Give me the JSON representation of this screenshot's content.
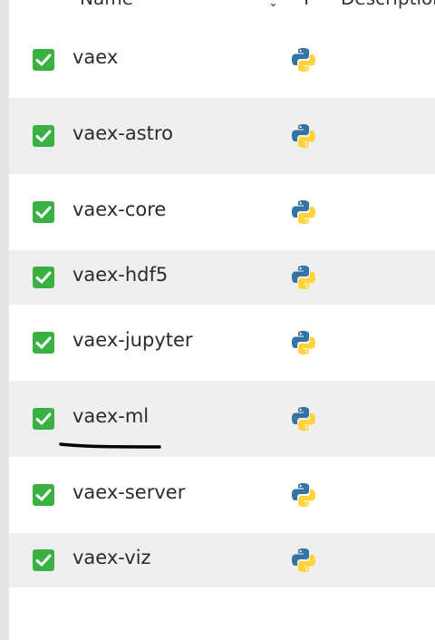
{
  "header": {
    "name_label": "Name",
    "sort_indicator": "⌄",
    "type_label": "T",
    "description_label": "Description"
  },
  "packages": [
    {
      "name": "vaex",
      "checked": true,
      "icon": "python-icon"
    },
    {
      "name": "vaex-astro",
      "checked": true,
      "icon": "python-icon"
    },
    {
      "name": "vaex-core",
      "checked": true,
      "icon": "python-icon"
    },
    {
      "name": "vaex-hdf5",
      "checked": true,
      "icon": "python-icon"
    },
    {
      "name": "vaex-jupyter",
      "checked": true,
      "icon": "python-icon"
    },
    {
      "name": "vaex-ml",
      "checked": true,
      "icon": "python-icon"
    },
    {
      "name": "vaex-server",
      "checked": true,
      "icon": "python-icon"
    },
    {
      "name": "vaex-viz",
      "checked": true,
      "icon": "python-icon"
    }
  ],
  "colors": {
    "checkbox": "#3bb143",
    "row_alt": "#efefef",
    "python_blue": "#3572a5",
    "python_yellow": "#ffd43b",
    "annotation": "#000000"
  }
}
